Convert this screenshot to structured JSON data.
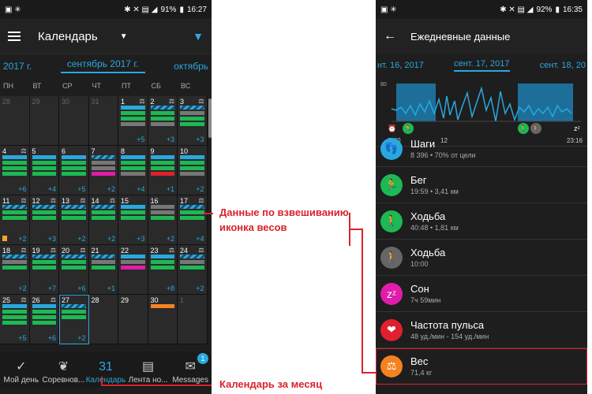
{
  "left": {
    "status": {
      "time": "16:27",
      "battery": "91%"
    },
    "topbar": {
      "title": "Календарь"
    },
    "months": {
      "prev": "2017 г.",
      "current": "сентябрь 2017 г.",
      "next": "октябрь"
    },
    "weekdays": [
      "ПН",
      "ВТ",
      "СР",
      "ЧТ",
      "ПТ",
      "СБ",
      "ВС"
    ],
    "days": [
      {
        "d": "28",
        "dim": true,
        "bars": [],
        "more": ""
      },
      {
        "d": "29",
        "dim": true,
        "bars": [],
        "more": ""
      },
      {
        "d": "30",
        "dim": true,
        "bars": [],
        "more": ""
      },
      {
        "d": "31",
        "dim": true,
        "bars": [],
        "more": ""
      },
      {
        "d": "1",
        "scale": true,
        "bars": [
          "blue",
          "green",
          "green",
          "gray"
        ],
        "more": "+5"
      },
      {
        "d": "2",
        "scale": true,
        "bars": [
          "stripe",
          "green",
          "green",
          "gray"
        ],
        "more": "+3"
      },
      {
        "d": "3",
        "scale": true,
        "bars": [
          "stripe",
          "gray",
          "green",
          "green"
        ],
        "more": "+3"
      },
      {
        "d": "4",
        "scale": true,
        "bars": [
          "blue",
          "green",
          "green",
          "green"
        ],
        "more": "+6"
      },
      {
        "d": "5",
        "bars": [
          "blue",
          "green",
          "green",
          "green"
        ],
        "more": "+4"
      },
      {
        "d": "6",
        "bars": [
          "blue",
          "green",
          "green",
          "green"
        ],
        "more": "+5"
      },
      {
        "d": "7",
        "bars": [
          "stripe",
          "gray",
          "gray",
          "magenta"
        ],
        "more": "+2"
      },
      {
        "d": "8",
        "bars": [
          "blue",
          "green",
          "green",
          "gray"
        ],
        "more": "+4"
      },
      {
        "d": "9",
        "bars": [
          "blue",
          "green",
          "green",
          "red"
        ],
        "more": "+1"
      },
      {
        "d": "10",
        "bars": [
          "blue",
          "green",
          "green",
          "gray"
        ],
        "more": "+2"
      },
      {
        "d": "11",
        "scale": true,
        "bars": [
          "stripe",
          "green",
          "green"
        ],
        "more": "+2",
        "flag": true
      },
      {
        "d": "12",
        "scale": true,
        "bars": [
          "stripe",
          "green",
          "green"
        ],
        "more": "+3"
      },
      {
        "d": "13",
        "scale": true,
        "bars": [
          "stripe",
          "green",
          "green"
        ],
        "more": "+2"
      },
      {
        "d": "14",
        "scale": true,
        "bars": [
          "stripe",
          "green",
          "green"
        ],
        "more": "+2"
      },
      {
        "d": "15",
        "bars": [
          "blue",
          "green",
          "green"
        ],
        "more": "+3"
      },
      {
        "d": "16",
        "bars": [
          "gray",
          "gray",
          "green"
        ],
        "more": "+2"
      },
      {
        "d": "17",
        "scale": true,
        "bars": [
          "stripe",
          "green",
          "green"
        ],
        "more": "+4"
      },
      {
        "d": "18",
        "scale": true,
        "bars": [
          "stripe",
          "gray",
          "green"
        ],
        "more": "+2"
      },
      {
        "d": "19",
        "scale": true,
        "bars": [
          "stripe",
          "green",
          "green"
        ],
        "more": "+7"
      },
      {
        "d": "20",
        "scale": true,
        "bars": [
          "stripe",
          "green",
          "green"
        ],
        "more": "+6"
      },
      {
        "d": "21",
        "bars": [
          "stripe",
          "gray",
          "green"
        ],
        "more": "+1"
      },
      {
        "d": "22",
        "bars": [
          "blue",
          "gray",
          "magenta"
        ],
        "more": ""
      },
      {
        "d": "23",
        "scale": true,
        "bars": [
          "blue",
          "green",
          "green"
        ],
        "more": "+8"
      },
      {
        "d": "24",
        "scale": true,
        "bars": [
          "stripe",
          "gray",
          "green"
        ],
        "more": "+2"
      },
      {
        "d": "25",
        "scale": true,
        "bars": [
          "blue",
          "green",
          "green",
          "green"
        ],
        "more": "+5"
      },
      {
        "d": "26",
        "scale": true,
        "bars": [
          "blue",
          "green",
          "green",
          "green"
        ],
        "more": "+6"
      },
      {
        "d": "27",
        "sel": true,
        "bars": [
          "stripe",
          "green",
          "green"
        ],
        "more": "+2"
      },
      {
        "d": "28",
        "bars": [],
        "more": ""
      },
      {
        "d": "29",
        "bars": [],
        "more": ""
      },
      {
        "d": "30",
        "bars": [
          "orange"
        ],
        "more": ""
      },
      {
        "d": "1",
        "dim": true,
        "bars": [],
        "more": ""
      }
    ],
    "nav": [
      {
        "label": "Мой день",
        "icon": "✓"
      },
      {
        "label": "Соревнов...",
        "icon": "❦"
      },
      {
        "label": "Календарь",
        "icon": "31",
        "active": true
      },
      {
        "label": "Лента но...",
        "icon": "▤"
      },
      {
        "label": "Messages",
        "icon": "✉",
        "badge": "1"
      }
    ]
  },
  "right": {
    "status": {
      "time": "16:35",
      "battery": "92%"
    },
    "topbar": {
      "title": "Ежедневные данные"
    },
    "dates": {
      "prev": "нт. 16, 2017",
      "current": "сент. 17, 2017",
      "next": "сент. 18, 20"
    },
    "chart": {
      "ytick": "80",
      "times": [
        "7:40",
        "12",
        "23:16"
      ]
    },
    "items": [
      {
        "title": "Шаги",
        "sub": "8 396 • 70% от цели",
        "color": "#29a8e0",
        "icon": "👣"
      },
      {
        "title": "Бег",
        "sub": "19:59 • 3,41 км",
        "color": "#1db954",
        "icon": "🏃"
      },
      {
        "title": "Ходьба",
        "sub": "40:48 • 1,81 км",
        "color": "#1db954",
        "icon": "🚶"
      },
      {
        "title": "Ходьба",
        "sub": "10:00",
        "color": "#666666",
        "icon": "🚶"
      },
      {
        "title": "Сон",
        "sub": "7ч 59мин",
        "color": "#e21caa",
        "icon": "zᶻ"
      },
      {
        "title": "Частота пульса",
        "sub": "48 уд./мин - 154 уд./мин",
        "color": "#e0202e",
        "icon": "❤"
      },
      {
        "title": "Вес",
        "sub": "71,4 кг",
        "color": "#f58220",
        "icon": "⚖"
      }
    ]
  },
  "annotations": {
    "weight_line1": "Данные по взвешиванию",
    "weight_line2": "иконка весов",
    "calendar": "Календарь за месяц"
  }
}
